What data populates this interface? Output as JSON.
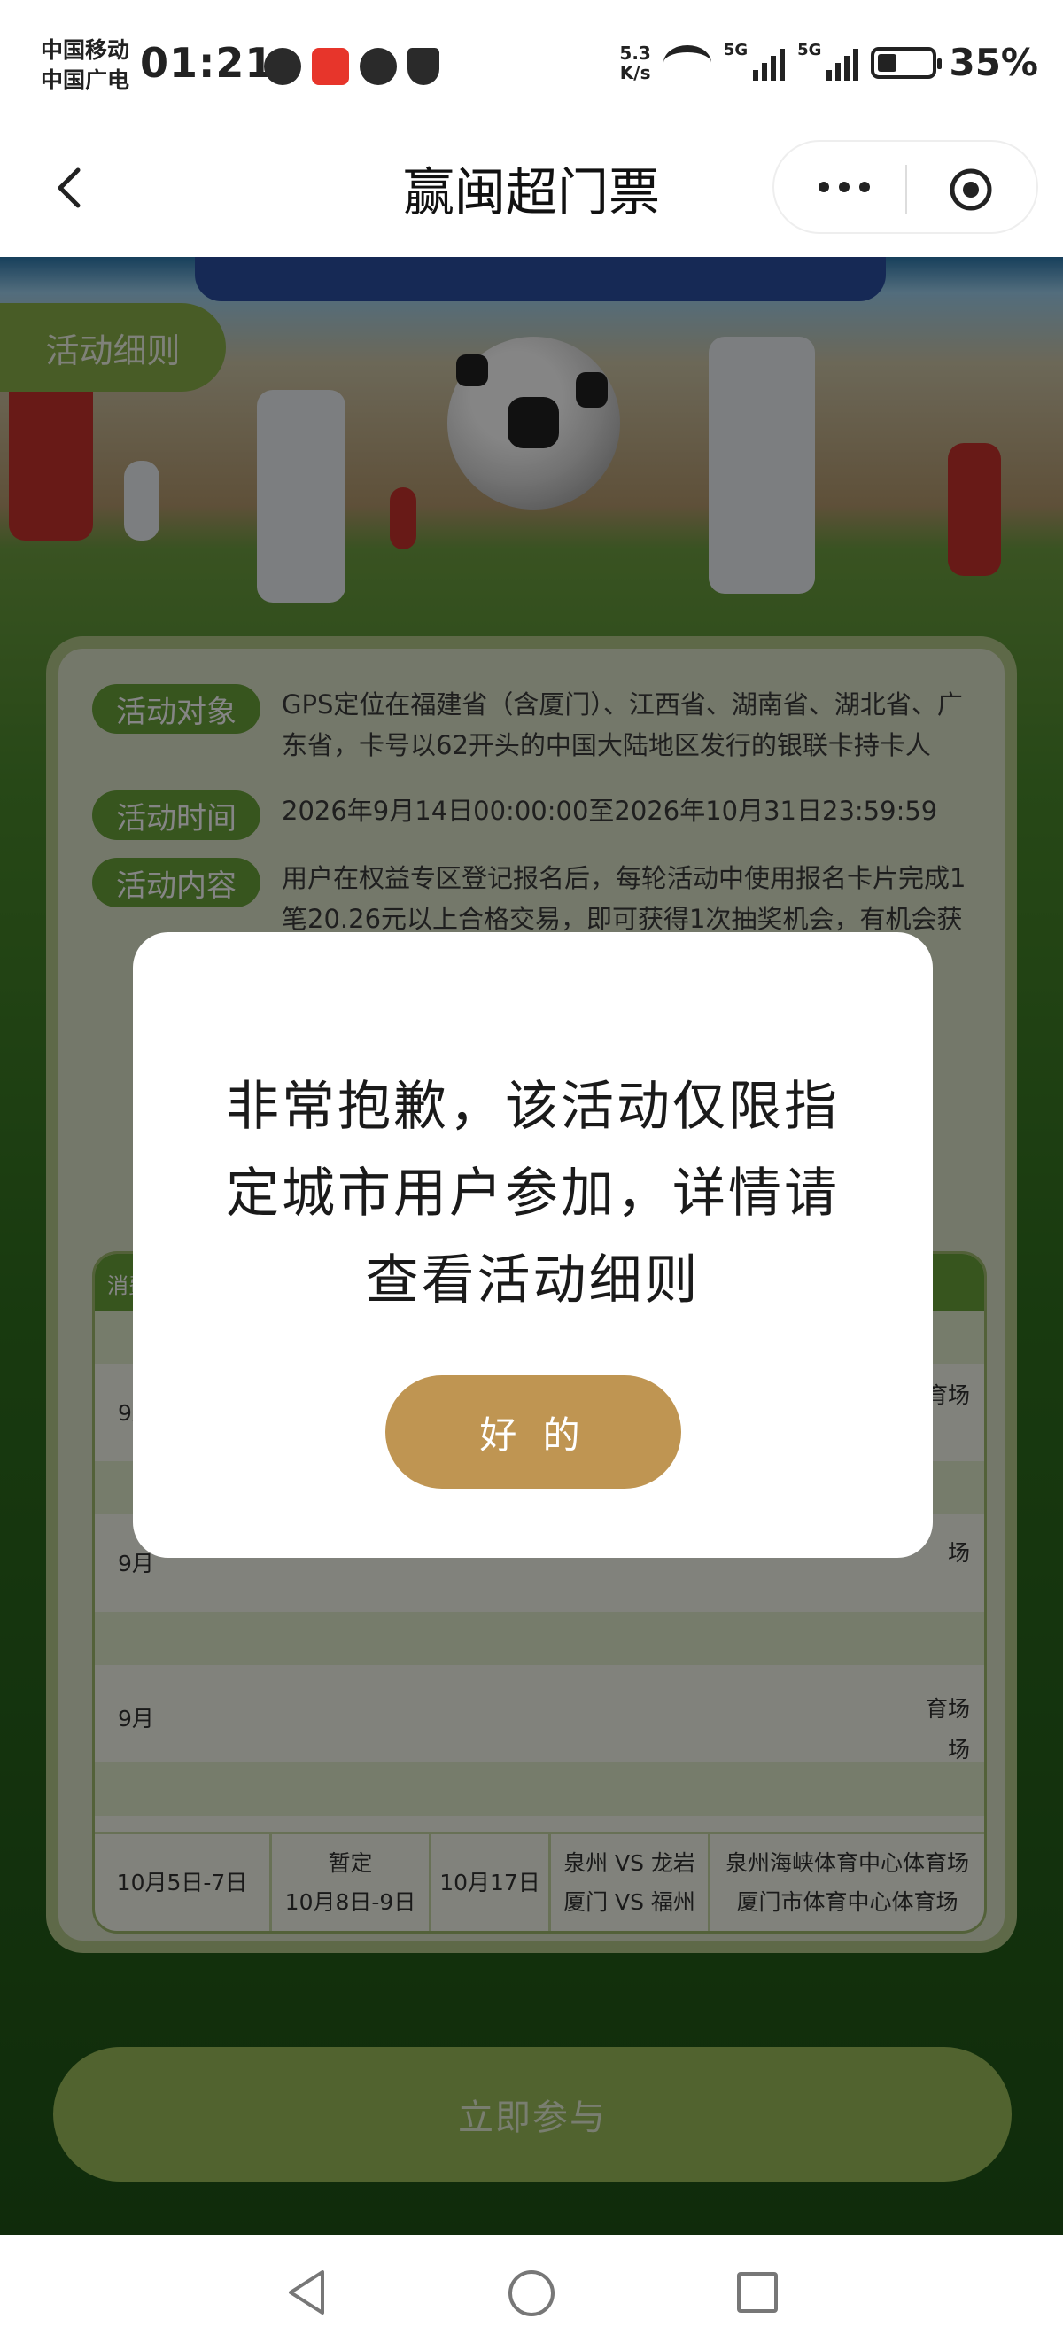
{
  "status_bar": {
    "carrier_1": "中国移动",
    "carrier_2": "中国广电",
    "time": "01:21",
    "net_speed_value": "5.3",
    "net_speed_unit": "K/s",
    "network_1": "5G",
    "network_2": "5G",
    "battery_percent": "35%",
    "battery_level": 0.35
  },
  "header": {
    "title": "赢闽超门票"
  },
  "page": {
    "rules_tab_label": "活动细则",
    "info_rows": [
      {
        "tag": "活动对象",
        "text": "GPS定位在福建省（含厦门）、江西省、湖南省、湖北省、广东省，卡号以62开头的中国大陆地区发行的银联卡持卡人"
      },
      {
        "tag": "活动时间",
        "text": "2026年9月14日00:00:00至2026年10月31日23:59:59"
      },
      {
        "tag": "活动内容",
        "text": "用户在权益专区登记报名后，每轮活动中使用报名卡片完成1笔20.26元以上合格交易，即可获得1次抽奖机会，有机会获得"
      }
    ],
    "table": {
      "header_partial": "消费",
      "row_partials": [
        "9月",
        "9月",
        "9月"
      ],
      "venue_partials": [
        "育场",
        "场",
        "育场",
        "场"
      ],
      "last_row": {
        "period": "10月5日-7日",
        "draw_label": "暂定",
        "draw_dates": "10月8日-9日",
        "match_date": "10月17日",
        "match_1": "泉州 VS 龙岩",
        "match_2": "厦门 VS 福州",
        "venue_1": "泉州海峡体育中心体育场",
        "venue_2": "厦门市体育中心体育场"
      }
    },
    "cta_label": "立即参与"
  },
  "modal": {
    "message": "非常抱歉，该活动仅限指定城市用户参加，详情请查看活动细则",
    "ok_label": "好 的"
  },
  "colors": {
    "modal_button": "#bf9552",
    "tag_green": "#6aa33a"
  }
}
